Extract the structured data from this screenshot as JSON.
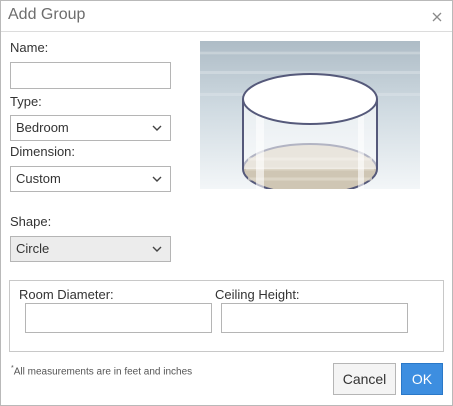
{
  "dialog": {
    "title": "Add Group"
  },
  "form": {
    "name_label": "Name:",
    "name_value": "",
    "type_label": "Type:",
    "type_value": "Bedroom",
    "dimension_label": "Dimension:",
    "dimension_value": "Custom",
    "shape_label": "Shape:",
    "shape_value": "Circle",
    "shape_disabled": true
  },
  "measurements": {
    "room_diameter_label": "Room Diameter:",
    "room_diameter_value": "",
    "ceiling_height_label": "Ceiling Height:",
    "ceiling_height_value": ""
  },
  "footer": {
    "note_marker": "*",
    "note_text": "All measurements are in feet and inches",
    "cancel_label": "Cancel",
    "ok_label": "OK"
  },
  "colors": {
    "ok_button": "#3d8ee0",
    "title_text": "#6d6d6d",
    "preview_floor": "#cfc6b4"
  },
  "icons": {
    "close": "close-icon",
    "dropdown": "chevron-down-icon"
  }
}
